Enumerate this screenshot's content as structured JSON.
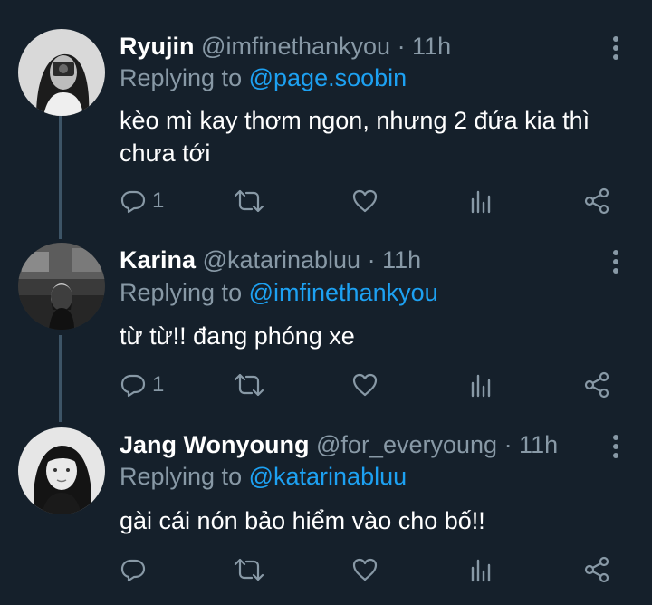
{
  "tweets": [
    {
      "name": "Ryujin",
      "handle": "@imfinethankyou",
      "time": "· 11h",
      "replying_label": "Replying to",
      "replying_to": "@page.soobin",
      "text": "kèo mì kay thơm ngon, nhưng 2 đứa kia thì chưa tới",
      "reply_count": "1"
    },
    {
      "name": "Karina",
      "handle": "@katarinabluu",
      "time": "· 11h",
      "replying_label": "Replying to",
      "replying_to": "@imfinethankyou",
      "text": "từ từ!! đang phóng xe",
      "reply_count": "1"
    },
    {
      "name": "Jang Wonyoung",
      "handle": "@for_everyoung",
      "time": "· 11h",
      "replying_label": "Replying to",
      "replying_to": "@katarinabluu",
      "text": "gài cái nón bảo hiểm vào cho bố!!",
      "reply_count": ""
    }
  ],
  "colors": {
    "background": "#15202b",
    "text_primary": "#ffffff",
    "text_secondary": "#8899a6",
    "mention": "#1da1f2",
    "thread_line": "#3d5466"
  },
  "icons": [
    "reply-icon",
    "retweet-icon",
    "like-icon",
    "analytics-icon",
    "share-icon",
    "more-options-icon"
  ]
}
